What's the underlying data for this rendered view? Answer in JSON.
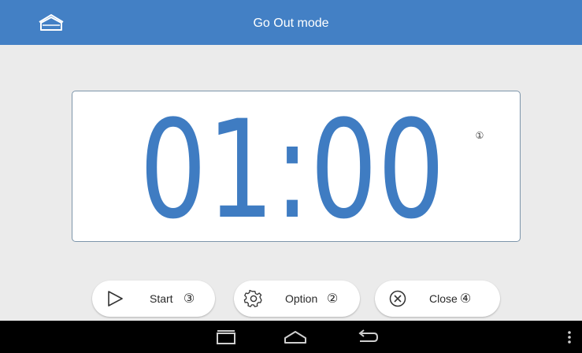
{
  "header": {
    "title": "Go Out mode",
    "background_color": "#4380c5",
    "home_icon": "home-house-icon"
  },
  "timer": {
    "display": "01:00",
    "digit_color": "#3f7cc2",
    "marker": "①"
  },
  "buttons": {
    "start": {
      "label": "Start",
      "marker": "③",
      "icon": "play-icon"
    },
    "option": {
      "label": "Option",
      "marker": "②",
      "icon": "gear-icon"
    },
    "close": {
      "label": "Close",
      "marker": "④",
      "icon": "close-circle-icon"
    }
  },
  "navbar": {
    "icons": [
      "recent-apps-icon",
      "home-icon",
      "back-icon",
      "overflow-menu-icon"
    ],
    "background_color": "#000000"
  }
}
